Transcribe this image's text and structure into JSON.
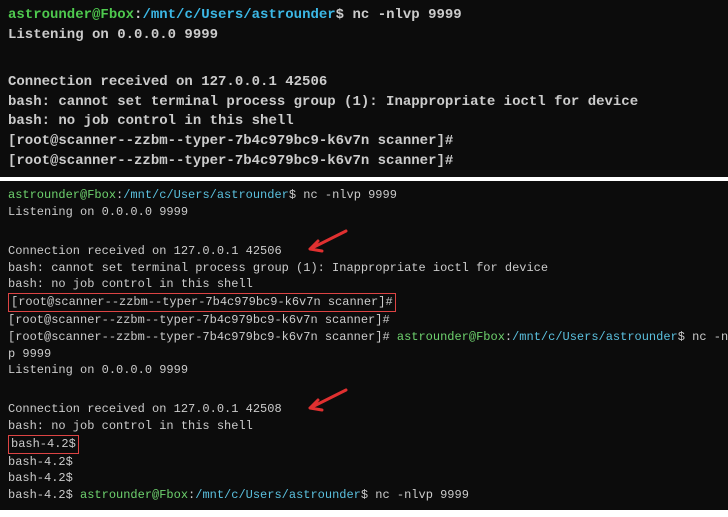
{
  "t1": {
    "prompt_user": "astrounder@Fbox",
    "prompt_path": "/mnt/c/Users/astrounder",
    "cmd1": "nc -nlvp 9999",
    "listen": "Listening on 0.0.0.0 9999",
    "conn": "Connection received on 127.0.0.1 42506",
    "bash1": "bash: cannot set terminal process group (1): Inappropriate ioctl for device",
    "bash2": "bash: no job control in this shell",
    "rootprompt": "[root@scanner--zzbm--typer-7b4c979bc9-k6v7n scanner]#"
  },
  "t2": {
    "prompt_user": "astrounder@Fbox",
    "prompt_path": "/mnt/c/Users/astrounder",
    "cmd1": "nc -nlvp 9999",
    "listen": "Listening on 0.0.0.0 9999",
    "conn1": "Connection received on 127.0.0.1 42506",
    "bash1": "bash: cannot set terminal process group (1): Inappropriate ioctl for device",
    "bash2": "bash: no job control in this shell",
    "rootprompt_hl": "[root@scanner--zzbm--typer-7b4c979bc9-k6v7n scanner]#",
    "rootprompt2": "[root@scanner--zzbm--typer-7b4c979bc9-k6v7n scanner]#",
    "rootprompt3_pre": "[root@scanner--zzbm--typer-7b4c979bc9-k6v7n scanner]# ",
    "cmd_wrap": "nc -nlv",
    "cmd_wrap2": "p 9999",
    "conn2": "Connection received on 127.0.0.1 42508",
    "bash3": "bash: no job control in this shell",
    "bash42_hl": "bash-4.2$",
    "bash42": "bash-4.2$",
    "bash42_pre": "bash-4.2$ ",
    "cmd2": "nc -nlvp 9999"
  }
}
